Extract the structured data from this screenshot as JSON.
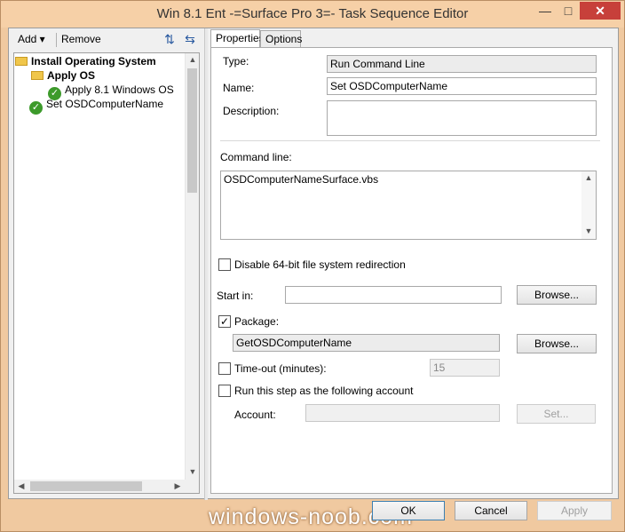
{
  "window": {
    "title": "Win 8.1 Ent -=Surface Pro 3=- Task Sequence Editor",
    "minimize": "—",
    "maximize": "□",
    "close": "✕"
  },
  "toolbar": {
    "add_label": "Add ▾",
    "remove_label": "Remove",
    "icon_move_up": "move-up-icon",
    "icon_move_down": "move-down-icon"
  },
  "tree": {
    "items": [
      {
        "label": "Install Operating System",
        "icon": "folder-icon",
        "bold": true
      },
      {
        "label": "Apply OS",
        "icon": "folder-icon",
        "bold": true
      },
      {
        "label": "Apply 8.1 Windows OS",
        "icon": "check-circle-icon",
        "bold": false
      },
      {
        "label": "Set OSDComputerName",
        "icon": "check-circle-icon",
        "bold": false
      }
    ]
  },
  "tabs": [
    {
      "label": "Properties"
    },
    {
      "label": "Options"
    }
  ],
  "properties": {
    "type_label": "Type:",
    "type_value": "Run Command Line",
    "name_label": "Name:",
    "name_value": "Set OSDComputerName",
    "description_label": "Description:",
    "description_value": "",
    "command_label": "Command line:",
    "command_value": "OSDComputerNameSurface.vbs",
    "disable64_label": "Disable 64-bit file system redirection",
    "disable64_checked": false,
    "startin_label": "Start in:",
    "startin_value": "",
    "browse_label": "Browse...",
    "package_label": "Package:",
    "package_checked": true,
    "package_value": "GetOSDComputerName",
    "timeout_label": "Time-out (minutes):",
    "timeout_checked": false,
    "timeout_value": "15",
    "runas_label": "Run this step as the following account",
    "runas_checked": false,
    "account_label": "Account:",
    "account_value": "",
    "set_label": "Set..."
  },
  "footer": {
    "ok_label": "OK",
    "cancel_label": "Cancel",
    "apply_label": "Apply",
    "watermark": "windows-noob.com"
  },
  "colors": {
    "title_bar": "#f6d0a7",
    "check_green": "#3d9a2b",
    "folder_yellow": "#f0c64a"
  }
}
